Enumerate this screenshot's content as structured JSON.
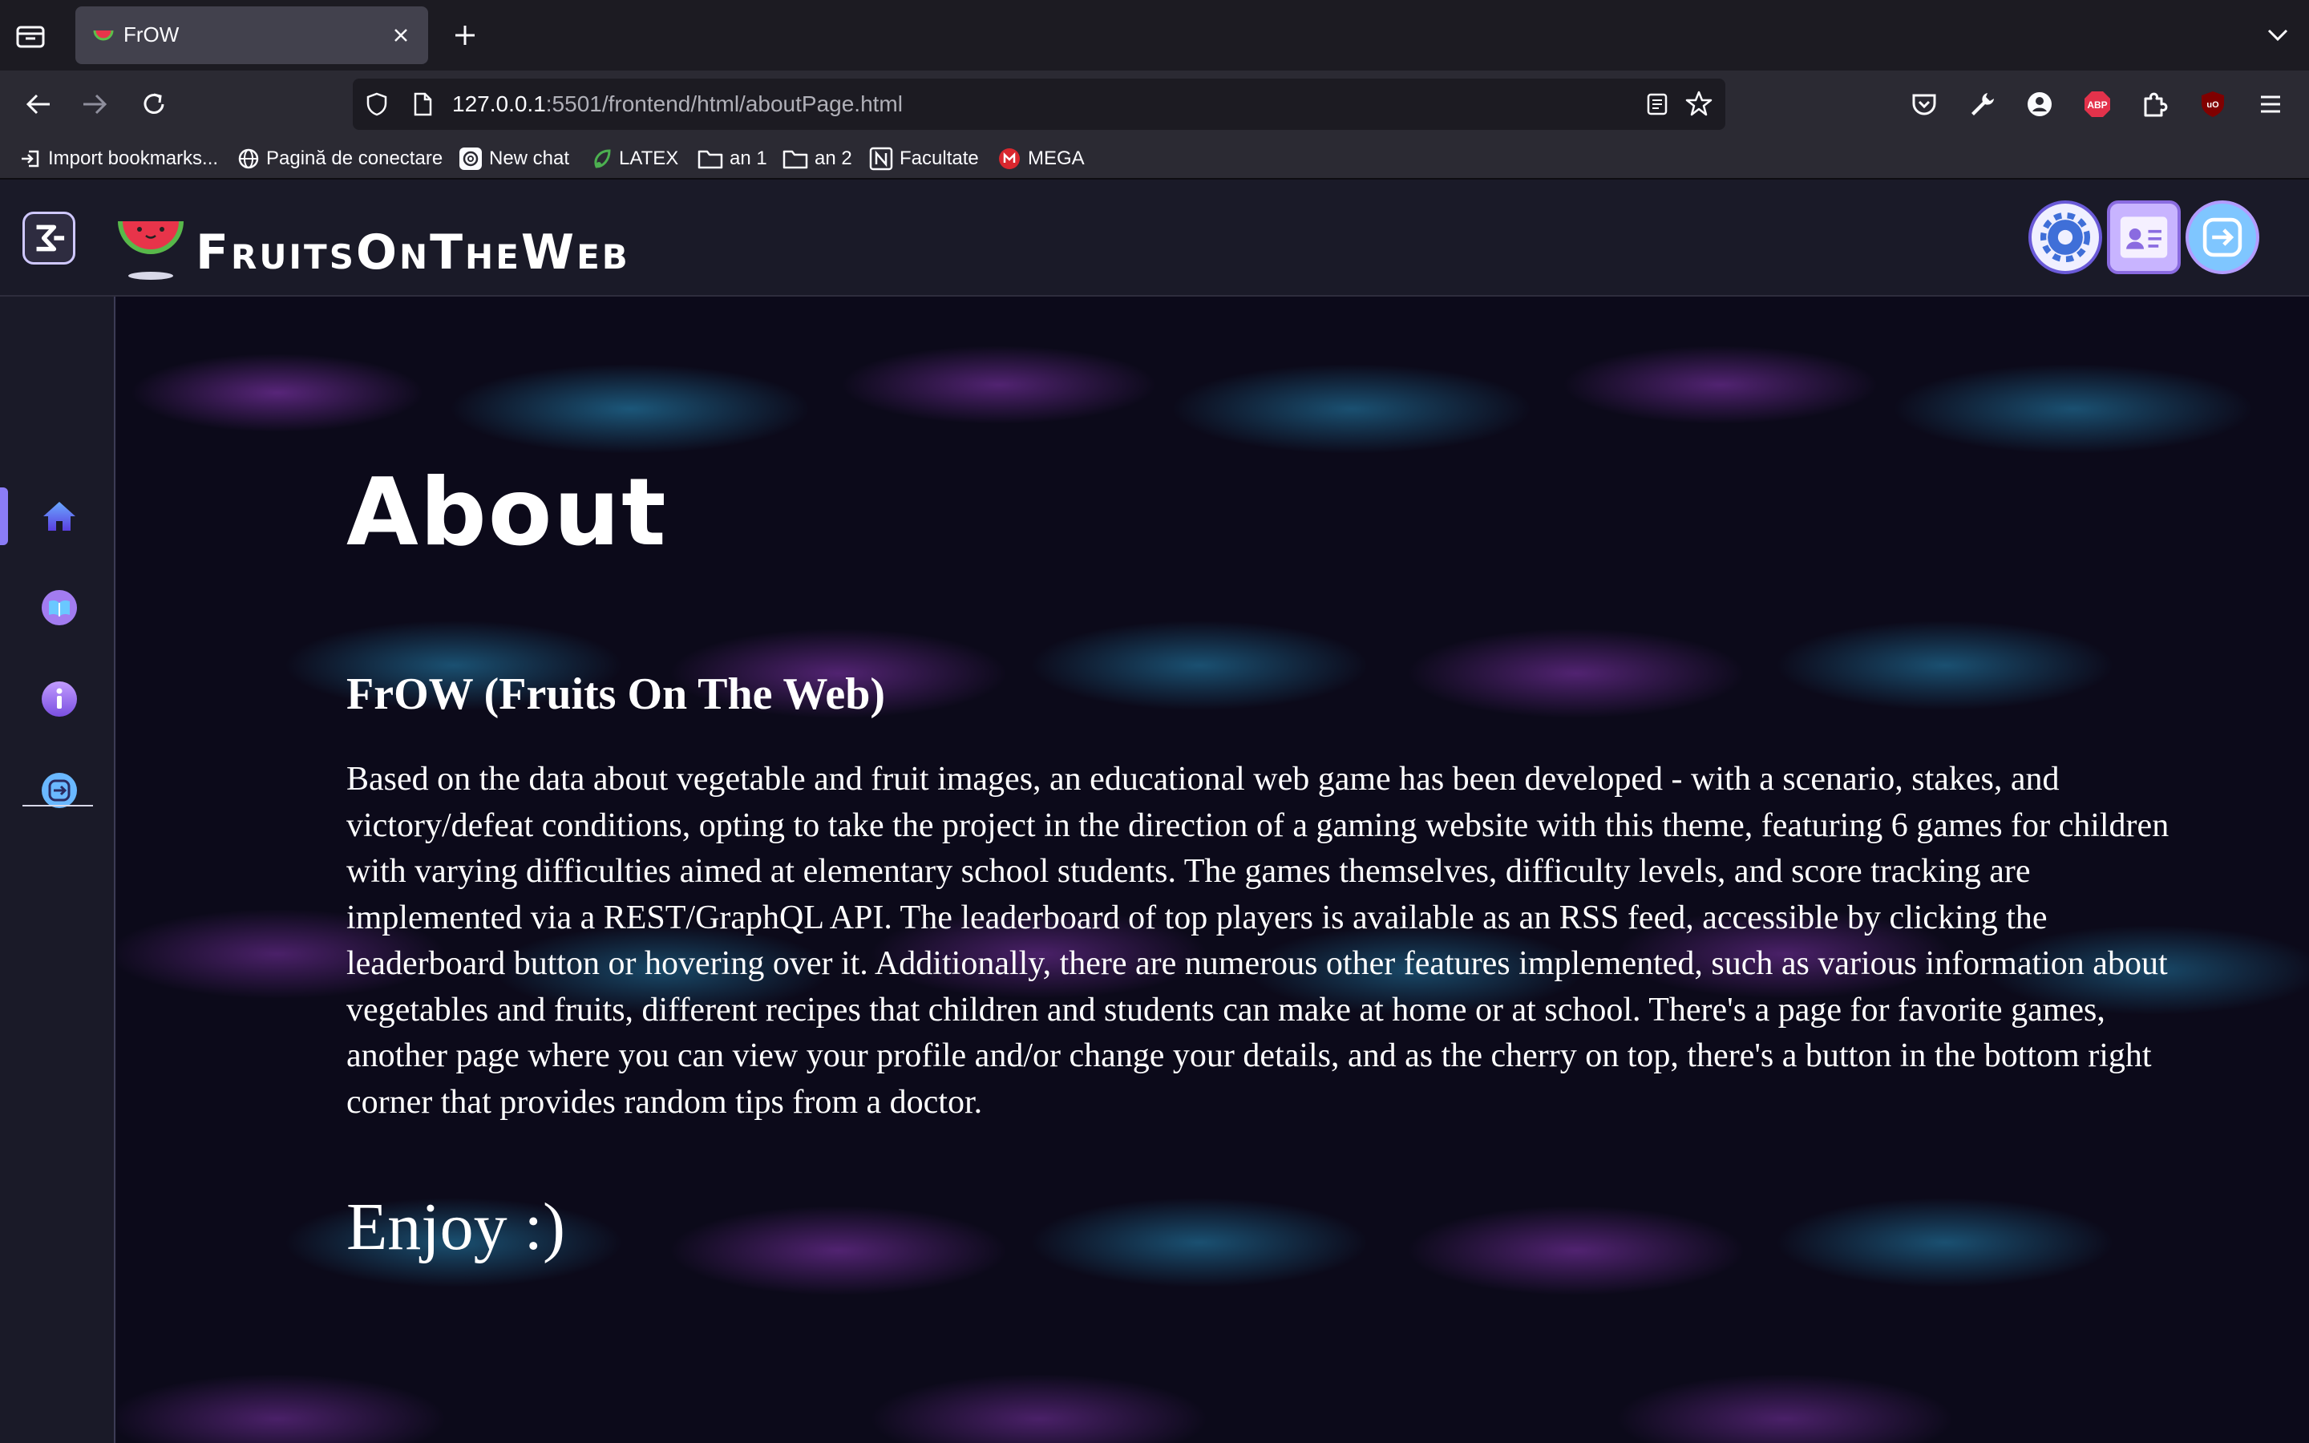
{
  "browser": {
    "tab": {
      "title": "FrOW"
    },
    "url": {
      "host": "127.0.0.1",
      "path": ":5501/frontend/html/aboutPage.html"
    },
    "bookmarks": [
      {
        "label": "Import bookmarks..."
      },
      {
        "label": "Pagină de conectare"
      },
      {
        "label": "New chat"
      },
      {
        "label": "LATEX"
      },
      {
        "label": "an 1"
      },
      {
        "label": "an 2"
      },
      {
        "label": "Facultate"
      },
      {
        "label": "MEGA"
      }
    ],
    "extensions": {
      "abp": "ABP",
      "ublock": "uO"
    }
  },
  "app": {
    "brand": "FruitsOnTheWeb",
    "sidebar": [
      "home-icon",
      "games-icon",
      "info-icon",
      "logout-icon"
    ],
    "header_buttons": [
      "settings-icon",
      "profile-icon",
      "logout-icon"
    ]
  },
  "about": {
    "title": "About",
    "subtitle": "FrOW (Fruits On The Web)",
    "body": "Based on the data about vegetable and fruit images, an educational web game has been developed - with a scenario, stakes, and victory/defeat conditions, opting to take the project in the direction of a gaming website with this theme, featuring 6 games for children with varying difficulties aimed at elementary school students. The games themselves, difficulty levels, and score tracking are implemented via a REST/GraphQL API. The leaderboard of top players is available as an RSS feed, accessible by clicking the leaderboard button or hovering over it. Additionally, there are numerous other features implemented, such as various information about vegetables and fruits, different recipes that children and students can make at home or at school. There's a page for favorite games, another page where you can view your profile and/or change your details, and as the cherry on top, there's a button in the bottom right corner that provides random tips from a doctor.",
    "closing": "Enjoy :)"
  },
  "colors": {
    "accent": "#8b7cf6",
    "chrome_bg": "#1c1b22",
    "toolbar_bg": "#2b2a33"
  }
}
